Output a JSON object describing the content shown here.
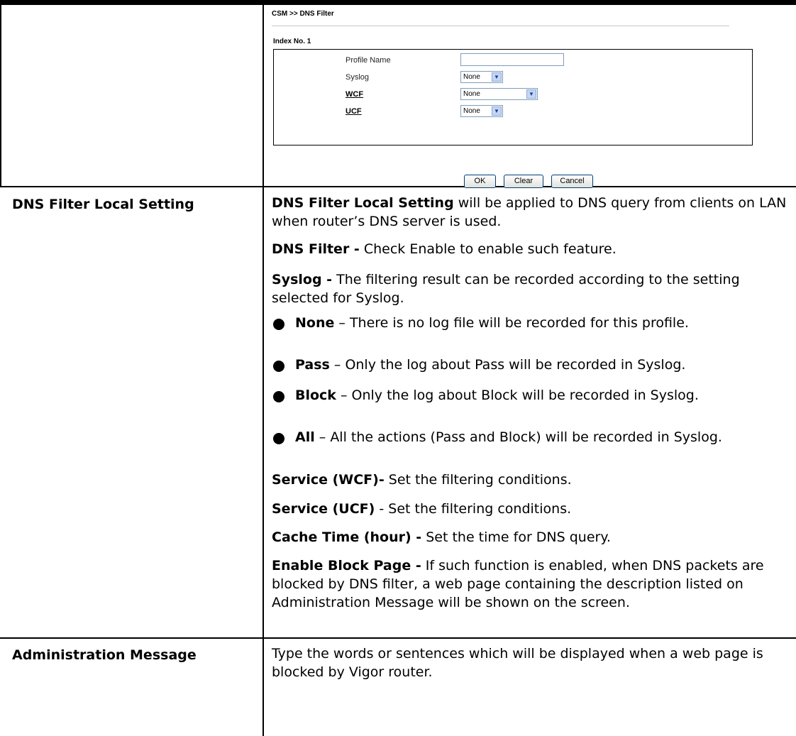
{
  "screenshot": {
    "breadcrumb": "CSM >> DNS Filter",
    "index_title": "Index No. 1",
    "fields": {
      "profile_name": {
        "label": "Profile Name",
        "value": ""
      },
      "syslog": {
        "label": "Syslog",
        "value": "None"
      },
      "wcf": {
        "label": "WCF",
        "value": "None"
      },
      "ucf": {
        "label": "UCF",
        "value": "None"
      }
    },
    "buttons": {
      "ok": "OK",
      "clear": "Clear",
      "cancel": "Cancel"
    }
  },
  "rows": {
    "local_setting": {
      "label": "DNS Filter Local Setting",
      "intro_bold": "DNS Filter Local Setting",
      "intro_rest": " will be applied to DNS query from clients on LAN when router’s DNS server is used.",
      "dns_filter_bold": "DNS Filter -",
      "dns_filter_rest": " Check Enable to enable such feature.",
      "syslog_bold": "Syslog -",
      "syslog_rest": " The filtering result can be recorded according to the setting selected for Syslog.",
      "bullets": [
        {
          "term": "None",
          "text": " – There is no log file will be recorded for this profile."
        },
        {
          "term": "Pass",
          "text": " – Only the log about Pass will be recorded in Syslog."
        },
        {
          "term": "Block",
          "text": " – Only the log about Block will be recorded in Syslog."
        },
        {
          "term": "All",
          "text": " – All the actions (Pass and Block) will be recorded in Syslog."
        }
      ],
      "wcf_bold": "Service (WCF)-",
      "wcf_rest": " Set the filtering conditions.",
      "ucf_bold": "Service (UCF)",
      "ucf_rest": " - Set the filtering conditions.",
      "cache_bold": "Cache Time (hour) -",
      "cache_rest": " Set the time for DNS query.",
      "block_page_bold": "Enable Block Page -",
      "block_page_rest": " If such function is enabled, when DNS packets are blocked by DNS filter, a web page containing the description listed on Administration Message will be shown on the screen."
    },
    "admin_message": {
      "label": "Administration Message",
      "text": "Type the words or sentences which will be displayed when a web page is blocked by Vigor router."
    }
  }
}
